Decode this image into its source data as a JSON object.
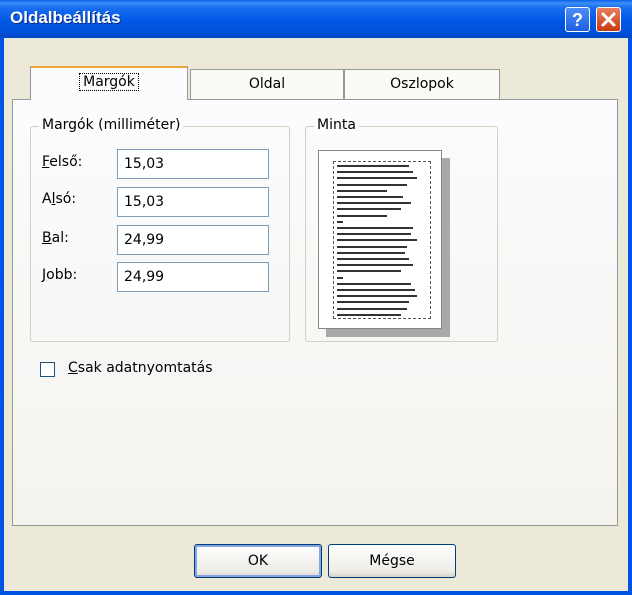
{
  "window": {
    "title": "Oldalbeállítás"
  },
  "tabs": [
    {
      "label": "Margók",
      "active": true
    },
    {
      "label": "Oldal",
      "active": false
    },
    {
      "label": "Oszlopok",
      "active": false
    }
  ],
  "margins": {
    "group_title": "Margók (milliméter)",
    "fields": [
      {
        "label": "Felső:",
        "value": "15,03"
      },
      {
        "label": "Alsó:",
        "value": "15,03"
      },
      {
        "label": "Bal:",
        "value": "24,99"
      },
      {
        "label": "Jobb:",
        "value": "24,99"
      }
    ]
  },
  "preview": {
    "group_title": "Minta"
  },
  "checkbox": {
    "label": "Csak adatnyomtatás",
    "checked": false
  },
  "buttons": {
    "ok": "OK",
    "cancel": "Mégse"
  },
  "icons": {
    "help": "help-icon",
    "close": "close-icon"
  },
  "colors": {
    "titlebar": "#0058e6",
    "close_button": "#c83a10",
    "dialog_bg": "#ece9d8"
  }
}
